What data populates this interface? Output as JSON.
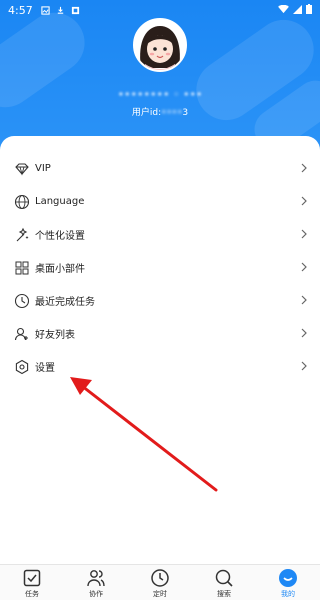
{
  "status_bar": {
    "time": "4:57"
  },
  "profile": {
    "username_obscured": "•••••••• ◦ •••",
    "user_id_label": "用户id:",
    "user_id_visible": "3",
    "user_id_obscured": "••••"
  },
  "menu": {
    "items": [
      {
        "label": "VIP",
        "icon": "diamond-icon"
      },
      {
        "label": "Language",
        "icon": "globe-icon"
      },
      {
        "label": "个性化设置",
        "icon": "magic-icon"
      },
      {
        "label": "桌面小部件",
        "icon": "widgets-icon"
      },
      {
        "label": "最近完成任务",
        "icon": "clock-icon"
      },
      {
        "label": "好友列表",
        "icon": "friends-icon"
      },
      {
        "label": "设置",
        "icon": "settings-icon"
      }
    ]
  },
  "bottom_nav": {
    "items": [
      {
        "label": "任务",
        "icon": "task-check-icon"
      },
      {
        "label": "协作",
        "icon": "people-icon"
      },
      {
        "label": "定时",
        "icon": "timer-icon"
      },
      {
        "label": "搜索",
        "icon": "search-icon"
      },
      {
        "label": "我的",
        "icon": "profile-smile-icon",
        "active": true
      }
    ]
  },
  "colors": {
    "accent": "#1e88f5",
    "annotation_arrow": "#e21b1b"
  }
}
